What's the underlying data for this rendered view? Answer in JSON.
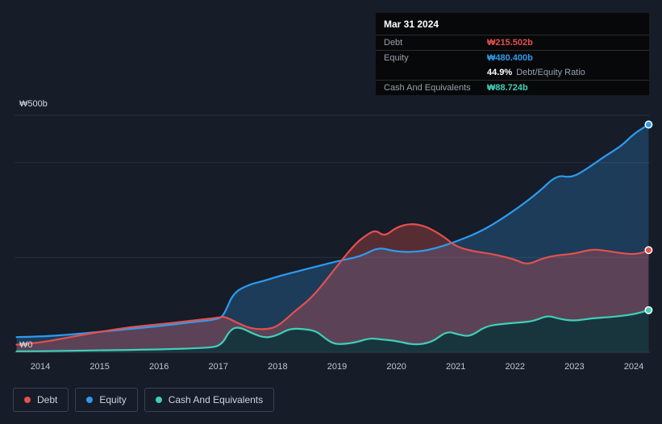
{
  "colors": {
    "background": "#161c28",
    "debt": "#e4504e",
    "equity": "#2e9bf0",
    "cash": "#3fd0b9",
    "gridline": "#273043",
    "baseline": "#323c50"
  },
  "tooltip": {
    "date": "Mar 31 2024",
    "debt": {
      "label": "Debt",
      "value": "₩215.502b"
    },
    "equity": {
      "label": "Equity",
      "value": "₩480.400b"
    },
    "ratio": {
      "value": "44.9%",
      "label": "Debt/Equity Ratio"
    },
    "cash": {
      "label": "Cash And Equivalents",
      "value": "₩88.724b"
    }
  },
  "axes": {
    "y_top_label": "₩500b",
    "y_bottom_label": "₩0",
    "x_labels": [
      "2014",
      "2015",
      "2016",
      "2017",
      "2018",
      "2019",
      "2020",
      "2021",
      "2022",
      "2023",
      "2024"
    ]
  },
  "legend": {
    "items": [
      {
        "label": "Debt",
        "color": "#e4504e"
      },
      {
        "label": "Equity",
        "color": "#2e9bf0"
      },
      {
        "label": "Cash And Equivalents",
        "color": "#3fd0b9"
      }
    ]
  },
  "chart_data": {
    "type": "area",
    "unit": "KRW billions",
    "x_range": [
      2013.6,
      2024.25
    ],
    "ylim": [
      0,
      500
    ],
    "gridline_values": [
      0,
      200,
      400,
      500
    ],
    "x_ticks": [
      2014,
      2015,
      2016,
      2017,
      2018,
      2019,
      2020,
      2021,
      2022,
      2023,
      2024
    ],
    "hover_date": "Mar 31 2024",
    "series": [
      {
        "name": "Equity",
        "color": "#2e9bf0",
        "fill": "rgba(46,155,240,0.25)",
        "z": 0,
        "final_value": 480.4,
        "points": [
          [
            2013.6,
            32
          ],
          [
            2014,
            33
          ],
          [
            2014.5,
            37
          ],
          [
            2015,
            43
          ],
          [
            2015.5,
            49
          ],
          [
            2016,
            55
          ],
          [
            2016.5,
            63
          ],
          [
            2017,
            69
          ],
          [
            2017.1,
            80
          ],
          [
            2017.25,
            125
          ],
          [
            2017.5,
            142
          ],
          [
            2017.75,
            150
          ],
          [
            2018,
            160
          ],
          [
            2018.5,
            176
          ],
          [
            2019,
            192
          ],
          [
            2019.4,
            202
          ],
          [
            2019.7,
            222
          ],
          [
            2019.95,
            213
          ],
          [
            2020.3,
            211
          ],
          [
            2020.6,
            217
          ],
          [
            2021,
            233
          ],
          [
            2021.5,
            259
          ],
          [
            2022,
            300
          ],
          [
            2022.4,
            338
          ],
          [
            2022.7,
            374
          ],
          [
            2022.95,
            368
          ],
          [
            2023.2,
            386
          ],
          [
            2023.5,
            413
          ],
          [
            2023.8,
            436
          ],
          [
            2024,
            461
          ],
          [
            2024.25,
            480.4
          ]
        ]
      },
      {
        "name": "Debt",
        "color": "#e4504e",
        "fill": "rgba(228,80,78,0.32)",
        "z": 1,
        "final_value": 215.502,
        "points": [
          [
            2013.6,
            16
          ],
          [
            2014,
            20
          ],
          [
            2014.5,
            32
          ],
          [
            2015,
            43
          ],
          [
            2015.5,
            53
          ],
          [
            2016,
            59
          ],
          [
            2016.5,
            66
          ],
          [
            2017,
            73
          ],
          [
            2017.1,
            76
          ],
          [
            2017.35,
            60
          ],
          [
            2017.55,
            50
          ],
          [
            2017.8,
            48
          ],
          [
            2018,
            54
          ],
          [
            2018.3,
            88
          ],
          [
            2018.6,
            118
          ],
          [
            2019,
            182
          ],
          [
            2019.3,
            228
          ],
          [
            2019.5,
            248
          ],
          [
            2019.65,
            258
          ],
          [
            2019.8,
            244
          ],
          [
            2020,
            264
          ],
          [
            2020.25,
            272
          ],
          [
            2020.5,
            266
          ],
          [
            2020.8,
            244
          ],
          [
            2021,
            223
          ],
          [
            2021.3,
            213
          ],
          [
            2021.6,
            208
          ],
          [
            2022,
            196
          ],
          [
            2022.2,
            184
          ],
          [
            2022.5,
            200
          ],
          [
            2022.8,
            206
          ],
          [
            2023,
            208
          ],
          [
            2023.3,
            218
          ],
          [
            2023.6,
            213
          ],
          [
            2023.9,
            207
          ],
          [
            2024.1,
            208
          ],
          [
            2024.25,
            215.5
          ]
        ]
      },
      {
        "name": "Cash And Equivalents",
        "color": "#3fd0b9",
        "fill": "rgba(18,52,60,0.92)",
        "z": 2,
        "final_value": 88.724,
        "points": [
          [
            2013.6,
            2
          ],
          [
            2014,
            2
          ],
          [
            2015,
            4
          ],
          [
            2016,
            6
          ],
          [
            2016.8,
            9
          ],
          [
            2017.05,
            14
          ],
          [
            2017.2,
            48
          ],
          [
            2017.35,
            54
          ],
          [
            2017.6,
            38
          ],
          [
            2017.8,
            30
          ],
          [
            2018,
            36
          ],
          [
            2018.2,
            50
          ],
          [
            2018.45,
            49
          ],
          [
            2018.65,
            45
          ],
          [
            2018.85,
            24
          ],
          [
            2019,
            16
          ],
          [
            2019.3,
            20
          ],
          [
            2019.55,
            30
          ],
          [
            2019.75,
            27
          ],
          [
            2020,
            24
          ],
          [
            2020.3,
            15
          ],
          [
            2020.6,
            21
          ],
          [
            2020.85,
            45
          ],
          [
            2021.05,
            37
          ],
          [
            2021.25,
            33
          ],
          [
            2021.5,
            55
          ],
          [
            2021.8,
            60
          ],
          [
            2022,
            62
          ],
          [
            2022.3,
            65
          ],
          [
            2022.55,
            78
          ],
          [
            2022.75,
            70
          ],
          [
            2023,
            66
          ],
          [
            2023.3,
            72
          ],
          [
            2023.6,
            74
          ],
          [
            2024,
            80
          ],
          [
            2024.25,
            88.7
          ]
        ]
      }
    ]
  }
}
